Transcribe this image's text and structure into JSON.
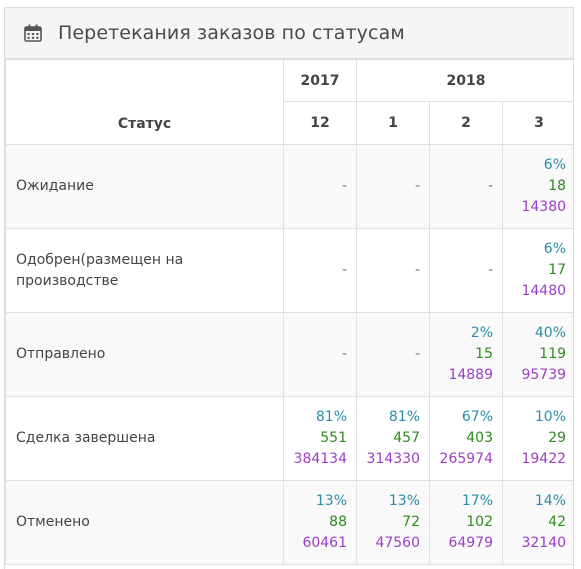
{
  "panel": {
    "title": "Перетекания заказов по статусам",
    "icon": "calendar-icon"
  },
  "table": {
    "status_header": "Статус",
    "years": [
      {
        "label": "2017"
      },
      {
        "label": "2018"
      }
    ],
    "months": [
      "12",
      "1",
      "2",
      "3"
    ],
    "dash": "-",
    "rows": [
      {
        "label": "Ожидание",
        "cells": [
          null,
          null,
          null,
          {
            "pct": "6%",
            "count": "18",
            "sum": "14380"
          }
        ]
      },
      {
        "label": "Одобрен(размещен на производстве",
        "cells": [
          null,
          null,
          null,
          {
            "pct": "6%",
            "count": "17",
            "sum": "14480"
          }
        ]
      },
      {
        "label": "Отправлено",
        "cells": [
          null,
          null,
          {
            "pct": "2%",
            "count": "15",
            "sum": "14889"
          },
          {
            "pct": "40%",
            "count": "119",
            "sum": "95739"
          }
        ]
      },
      {
        "label": "Сделка завершена",
        "cells": [
          {
            "pct": "81%",
            "count": "551",
            "sum": "384134"
          },
          {
            "pct": "81%",
            "count": "457",
            "sum": "314330"
          },
          {
            "pct": "67%",
            "count": "403",
            "sum": "265974"
          },
          {
            "pct": "10%",
            "count": "29",
            "sum": "19422"
          }
        ]
      },
      {
        "label": "Отменено",
        "cells": [
          {
            "pct": "13%",
            "count": "88",
            "sum": "60461"
          },
          {
            "pct": "13%",
            "count": "72",
            "sum": "47560"
          },
          {
            "pct": "17%",
            "count": "102",
            "sum": "64979"
          },
          {
            "pct": "14%",
            "count": "42",
            "sum": "32140"
          }
        ]
      }
    ]
  },
  "colors": {
    "pct": "#2a8caa",
    "count": "#2e8b1e",
    "sum": "#9b3fc7"
  }
}
